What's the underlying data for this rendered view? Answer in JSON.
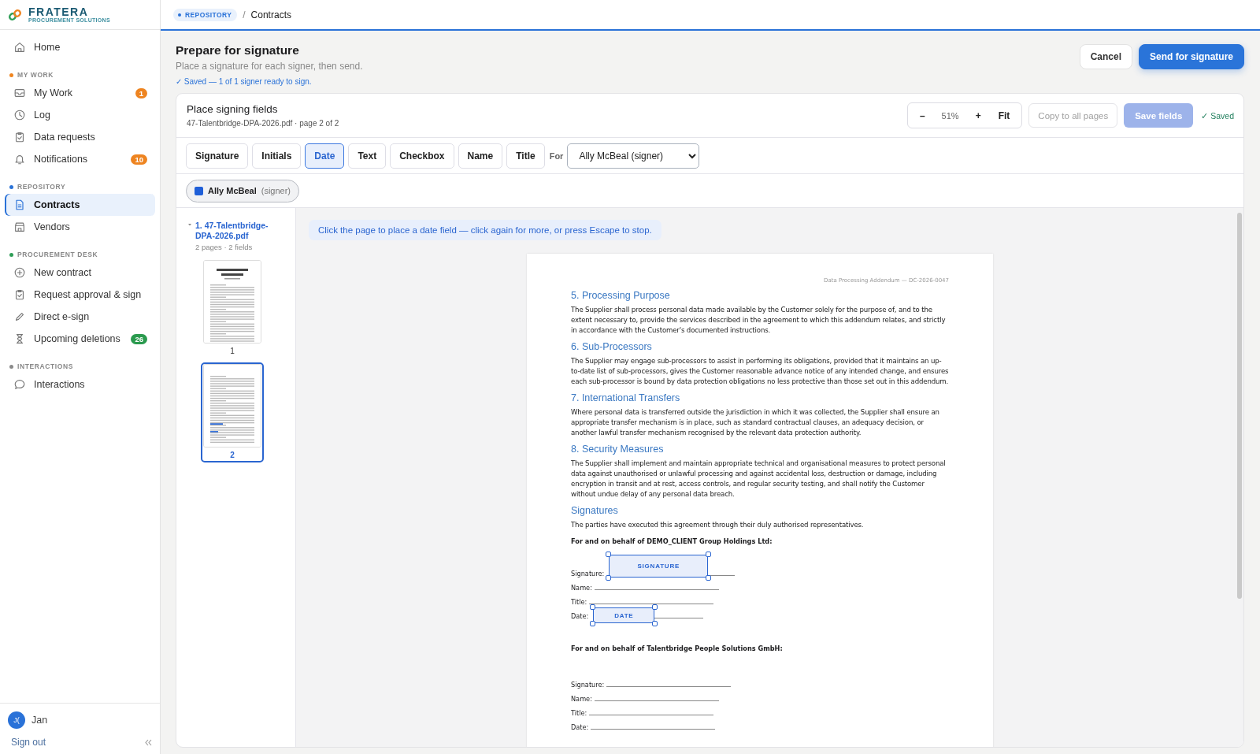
{
  "brand": {
    "name": "FRATERA",
    "tagline": "PROCUREMENT SOLUTIONS"
  },
  "sidebar": {
    "home": {
      "label": "Home",
      "selected": false
    },
    "sections": [
      {
        "title": "MY WORK",
        "color": "#f0851f",
        "items": [
          {
            "label": "My Work",
            "selected": false,
            "badge": {
              "text": "1",
              "color": "#ee8420"
            }
          },
          {
            "label": "Log",
            "selected": false
          },
          {
            "label": "Data requests",
            "selected": false
          },
          {
            "label": "Notifications",
            "selected": false,
            "badge": {
              "text": "10",
              "color": "#ee8420"
            }
          }
        ]
      },
      {
        "title": "REPOSITORY",
        "color": "#2a72d8",
        "items": [
          {
            "label": "Contracts",
            "selected": true
          },
          {
            "label": "Vendors",
            "selected": false
          }
        ]
      },
      {
        "title": "PROCUREMENT DESK",
        "color": "#2f9e57",
        "items": [
          {
            "label": "New contract",
            "selected": false
          },
          {
            "label": "Request approval & sign",
            "selected": false
          },
          {
            "label": "Direct e-sign",
            "selected": false
          },
          {
            "label": "Upcoming deletions",
            "selected": false,
            "badge": {
              "text": "26",
              "color": "#2a9a4e"
            }
          }
        ]
      },
      {
        "title": "INTERACTIONS",
        "color": "#8a8a8a",
        "items": [
          {
            "label": "Interactions",
            "selected": false
          }
        ]
      }
    ],
    "user": {
      "initials": "J(",
      "name": "Jan"
    },
    "sign_out": "Sign out"
  },
  "breadcrumb": {
    "section": "REPOSITORY",
    "separator": "/",
    "page": "Contracts"
  },
  "header": {
    "title": "Prepare for signature",
    "subtitle": "Place a signature for each signer, then send.",
    "status": "✓ Saved — 1 of 1 signer ready to sign.",
    "buttons": [
      {
        "label": "Cancel",
        "kind": "secondary"
      },
      {
        "label": "Send for signature",
        "kind": "primary"
      }
    ]
  },
  "card": {
    "title": "Place signing fields",
    "file": "47-Talentbridge-DPA-2026.pdf · page 2 of 2",
    "zoom": {
      "minus": "–",
      "value": "51%",
      "plus": "+",
      "fit": "Fit"
    },
    "copy_button": {
      "label": "Copy to all pages",
      "disabled": true
    },
    "save_button": {
      "label": "Save fields",
      "disabled": true
    },
    "saved": "✓ Saved",
    "field_types": [
      {
        "label": "Signature",
        "selected": false
      },
      {
        "label": "Initials",
        "selected": false
      },
      {
        "label": "Date",
        "selected": true
      },
      {
        "label": "Text",
        "selected": false
      },
      {
        "label": "Checkbox",
        "selected": false
      },
      {
        "label": "Name",
        "selected": false
      },
      {
        "label": "Title",
        "selected": false
      }
    ],
    "for_label": "For",
    "signer_select": "Ally McBeal (signer)",
    "signer_chip": {
      "name": "Ally McBeal",
      "role": "(signer)",
      "color": "#1f5fd8"
    }
  },
  "documents": [
    {
      "title": "1. 47-Talentbridge-DPA-2026.pdf",
      "meta": "2 pages · 2 fields",
      "pages": [
        {
          "number": "1",
          "selected": false
        },
        {
          "number": "2",
          "selected": true
        }
      ]
    }
  ],
  "hint": "Click the page to place a date field — click again for more, or press Escape to stop.",
  "page": {
    "running_header": "Data Processing Addendum — DC-2026-0047",
    "sections": [
      {
        "heading": "5. Processing Purpose",
        "body": "The Supplier shall process personal data made available by the Customer solely for the purpose of, and to the extent necessary to, provide the services described in the agreement to which this addendum relates, and strictly in accordance with the Customer's documented instructions."
      },
      {
        "heading": "6. Sub-Processors",
        "body": "The Supplier may engage sub-processors to assist in performing its obligations, provided that it maintains an up-to-date list of sub-processors, gives the Customer reasonable advance notice of any intended change, and ensures each sub-processor is bound by data protection obligations no less protective than those set out in this addendum."
      },
      {
        "heading": "7. International Transfers",
        "body": "Where personal data is transferred outside the jurisdiction in which it was collected, the Supplier shall ensure an appropriate transfer mechanism is in place, such as standard contractual clauses, an adequacy decision, or another lawful transfer mechanism recognised by the relevant data protection authority."
      },
      {
        "heading": "8. Security Measures",
        "body": "The Supplier shall implement and maintain appropriate technical and organisational measures to protect personal data against unauthorised or unlawful processing and against accidental loss, destruction or damage, including encryption in transit and at rest, access controls, and regular security testing, and shall notify the Customer without undue delay of any personal data breach."
      }
    ],
    "signatures": {
      "heading": "Signatures",
      "intro": "The parties have executed this agreement through their duly authorised representatives.",
      "parties": [
        {
          "title": "For and on behalf of DEMO_CLIENT Group Holdings Ltd:",
          "lines": [
            {
              "label": "Signature:",
              "field": {
                "kind": "signature",
                "label": "SIGNATURE"
              }
            },
            {
              "label": "Name:"
            },
            {
              "label": "Title:"
            },
            {
              "label": "Date:",
              "field": {
                "kind": "date",
                "label": "DATE"
              }
            }
          ]
        },
        {
          "title": "For and on behalf of Talentbridge People Solutions GmbH:",
          "lines": [
            {
              "label": "Signature:"
            },
            {
              "label": "Name:"
            },
            {
              "label": "Title:"
            },
            {
              "label": "Date:"
            }
          ]
        }
      ]
    }
  }
}
